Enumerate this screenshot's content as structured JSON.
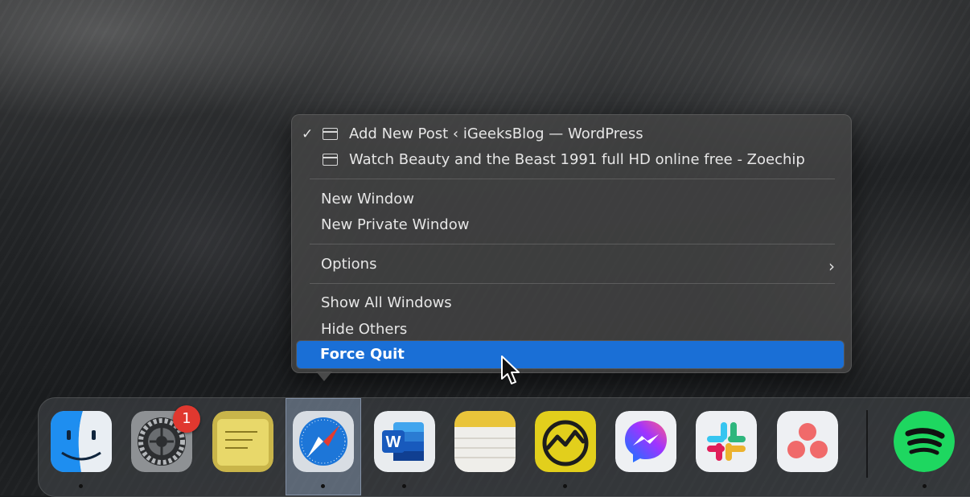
{
  "menu": {
    "windows": [
      {
        "label": "Add New Post ‹ iGeeksBlog — WordPress",
        "checked": true
      },
      {
        "label": "Watch Beauty and the Beast 1991 full HD online free - Zoechip",
        "checked": false
      }
    ],
    "check_glyph": "✓",
    "new_window": "New Window",
    "new_private_window": "New Private Window",
    "options": "Options",
    "options_chevron": "›",
    "show_all_windows": "Show All Windows",
    "hide_others": "Hide Others",
    "force_quit": "Force Quit",
    "highlight_color": "#1a6fd6"
  },
  "dock": {
    "apps": [
      {
        "name": "Finder",
        "icon": "finder-icon",
        "running": true
      },
      {
        "name": "System Preferences",
        "icon": "gear-icon",
        "running": false,
        "badge": "1"
      },
      {
        "name": "Stickies",
        "icon": "stickies-icon",
        "running": false
      },
      {
        "name": "Safari",
        "icon": "safari-compass-icon",
        "running": true,
        "selected": true
      },
      {
        "name": "Microsoft Word",
        "icon": "word-icon",
        "running": true
      },
      {
        "name": "Notes",
        "icon": "notes-icon",
        "running": false
      },
      {
        "name": "Basecamp",
        "icon": "basecamp-icon",
        "running": true
      },
      {
        "name": "Messenger",
        "icon": "messenger-icon",
        "running": false
      },
      {
        "name": "Slack",
        "icon": "slack-icon",
        "running": false
      },
      {
        "name": "Asana",
        "icon": "asana-icon",
        "running": false
      },
      {
        "name": "Spotify",
        "icon": "spotify-icon",
        "running": true
      }
    ],
    "badge_color": "#e0382f"
  }
}
